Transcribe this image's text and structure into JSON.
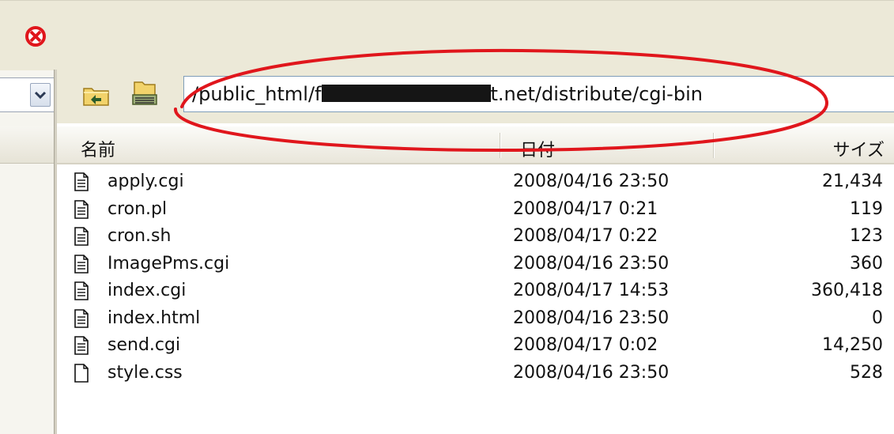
{
  "path_bar": {
    "path_prefix": "/public_html/f",
    "path_suffix": "t.net/distribute/cgi-bin"
  },
  "columns": {
    "name": "名前",
    "date": "日付",
    "size": "サイズ"
  },
  "files": [
    {
      "name": "apply.cgi",
      "date": "2008/04/16 23:50",
      "size": "21,434",
      "icon": "text-file-icon"
    },
    {
      "name": "cron.pl",
      "date": "2008/04/17  0:21",
      "size": "119",
      "icon": "text-file-icon"
    },
    {
      "name": "cron.sh",
      "date": "2008/04/17  0:22",
      "size": "123",
      "icon": "text-file-icon"
    },
    {
      "name": "ImagePms.cgi",
      "date": "2008/04/16 23:50",
      "size": "360",
      "icon": "text-file-icon"
    },
    {
      "name": "index.cgi",
      "date": "2008/04/17 14:53",
      "size": "360,418",
      "icon": "text-file-icon"
    },
    {
      "name": "index.html",
      "date": "2008/04/16 23:50",
      "size": "0",
      "icon": "text-file-icon"
    },
    {
      "name": "send.cgi",
      "date": "2008/04/17  0:02",
      "size": "14,250",
      "icon": "text-file-icon"
    },
    {
      "name": "style.css",
      "date": "2008/04/16 23:50",
      "size": "528",
      "icon": "blank-file-icon"
    }
  ],
  "colors": {
    "annotation": "#e0161c",
    "toolbar_bg": "#ece9d8",
    "input_border": "#7f9db9"
  },
  "icons": [
    "stop-icon",
    "folder-up-icon",
    "drive-icon",
    "chevron-down-icon",
    "text-file-icon",
    "blank-file-icon"
  ]
}
